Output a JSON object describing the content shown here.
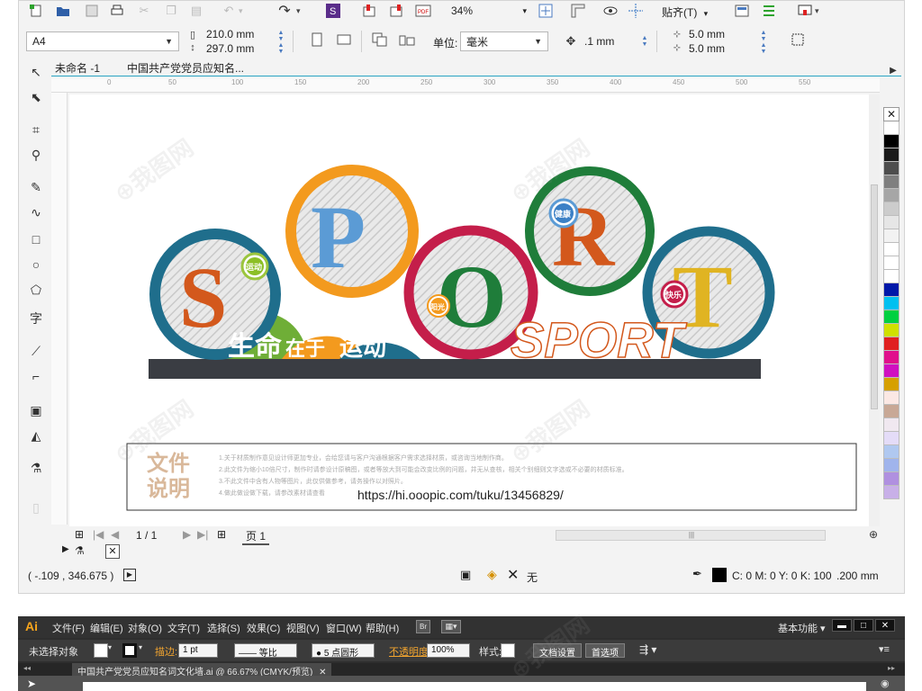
{
  "corel": {
    "toolbar1": {
      "zoom": "34%",
      "snap_label": "贴齐(T)"
    },
    "toolbar2": {
      "paper_size": "A4",
      "width": "210.0 mm",
      "height": "297.0 mm",
      "unit_label": "单位:",
      "unit_value": "毫米",
      "nudge": ".1 mm",
      "dup_x": "5.0 mm",
      "dup_y": "5.0 mm"
    },
    "tabs": [
      "未命名 -1",
      "中国共产党党员应知名..."
    ],
    "ruler_ticks": [
      "0",
      "50",
      "100",
      "150",
      "200",
      "250",
      "300",
      "350",
      "400",
      "450",
      "500",
      "550"
    ],
    "artwork": {
      "letters": [
        "S",
        "P",
        "O",
        "R",
        "T"
      ],
      "badges": [
        "运动",
        "健康",
        "阳光",
        "快乐"
      ],
      "slogan_part1": "生命",
      "slogan_part2": "在于",
      "slogan_part3": "运动",
      "sport_word": "SPORT"
    },
    "note": {
      "title_line1": "文件",
      "title_line2": "说明",
      "lines": [
        "1.关于材质制作意见设计师更加专业，会给您请与客户沟通根据客户需求选择材质，或咨询当地制作商。",
        "2.此文件为缩小10倍尺寸，制作时请参设计原稿图，或者等放大到可能会改变比例的问题，并无从查核，相关个别细则文字选或不必要的材质标准。",
        "3.不此文件中含有人物等图片，此仅供做参考，请务操作以对照片。",
        "4.做此做设做下载，请参改素材请查看"
      ],
      "url": "https://hi.ooopic.com/tuku/13456829/"
    },
    "pager": {
      "page": "1 / 1",
      "page_tab": "页 1"
    },
    "status": {
      "coords": "( -.109 , 346.675 )",
      "fill_label": "无",
      "color_info": "C: 0 M: 0 Y: 0 K: 100",
      "stroke_width": ".200 mm"
    },
    "colors": {
      "teal": "#1f6e8c",
      "orange": "#f39a1e",
      "red": "#c41e4a",
      "green": "#1f7d3a",
      "rust": "#d3581c",
      "blue": "#5b9bd5",
      "yellow": "#e0b422",
      "dark": "#3a3d43"
    },
    "palette": [
      "#ffffff",
      "#000000",
      "#1a1a1a",
      "#4d4d4d",
      "#7f7f7f",
      "#a6a6a6",
      "#cccccc",
      "#e6e6e6",
      "#f2f2f2",
      "#ffffff",
      "#ffffff",
      "#ffffff",
      "#0018a8",
      "#00c0f0",
      "#00d040",
      "#d0e000",
      "#e02020",
      "#e0108c",
      "#d010c0",
      "#d6a000",
      "#fbe8e4",
      "#c8a896",
      "#f0e8f0",
      "#e4dcf8",
      "#b0c8f0",
      "#a0b4ec",
      "#b090e0",
      "#c8b0e8"
    ]
  },
  "illustrator": {
    "logo": "Ai",
    "menu": [
      "文件(F)",
      "编辑(E)",
      "对象(O)",
      "文字(T)",
      "选择(S)",
      "效果(C)",
      "视图(V)",
      "窗口(W)",
      "帮助(H)"
    ],
    "workspace": "基本功能",
    "control": {
      "no_selection": "未选择对象",
      "stroke_label": "描边:",
      "stroke_value": "1 pt",
      "line_style": "等比",
      "brush": "5 点圆形",
      "opacity_label": "不透明度:",
      "opacity_value": "100%",
      "style_label": "样式:",
      "doc_setup": "文档设置",
      "prefs": "首选项"
    },
    "doc_tab": "中国共产党党员应知名词文化墙.ai @ 66.67% (CMYK/预览)"
  }
}
